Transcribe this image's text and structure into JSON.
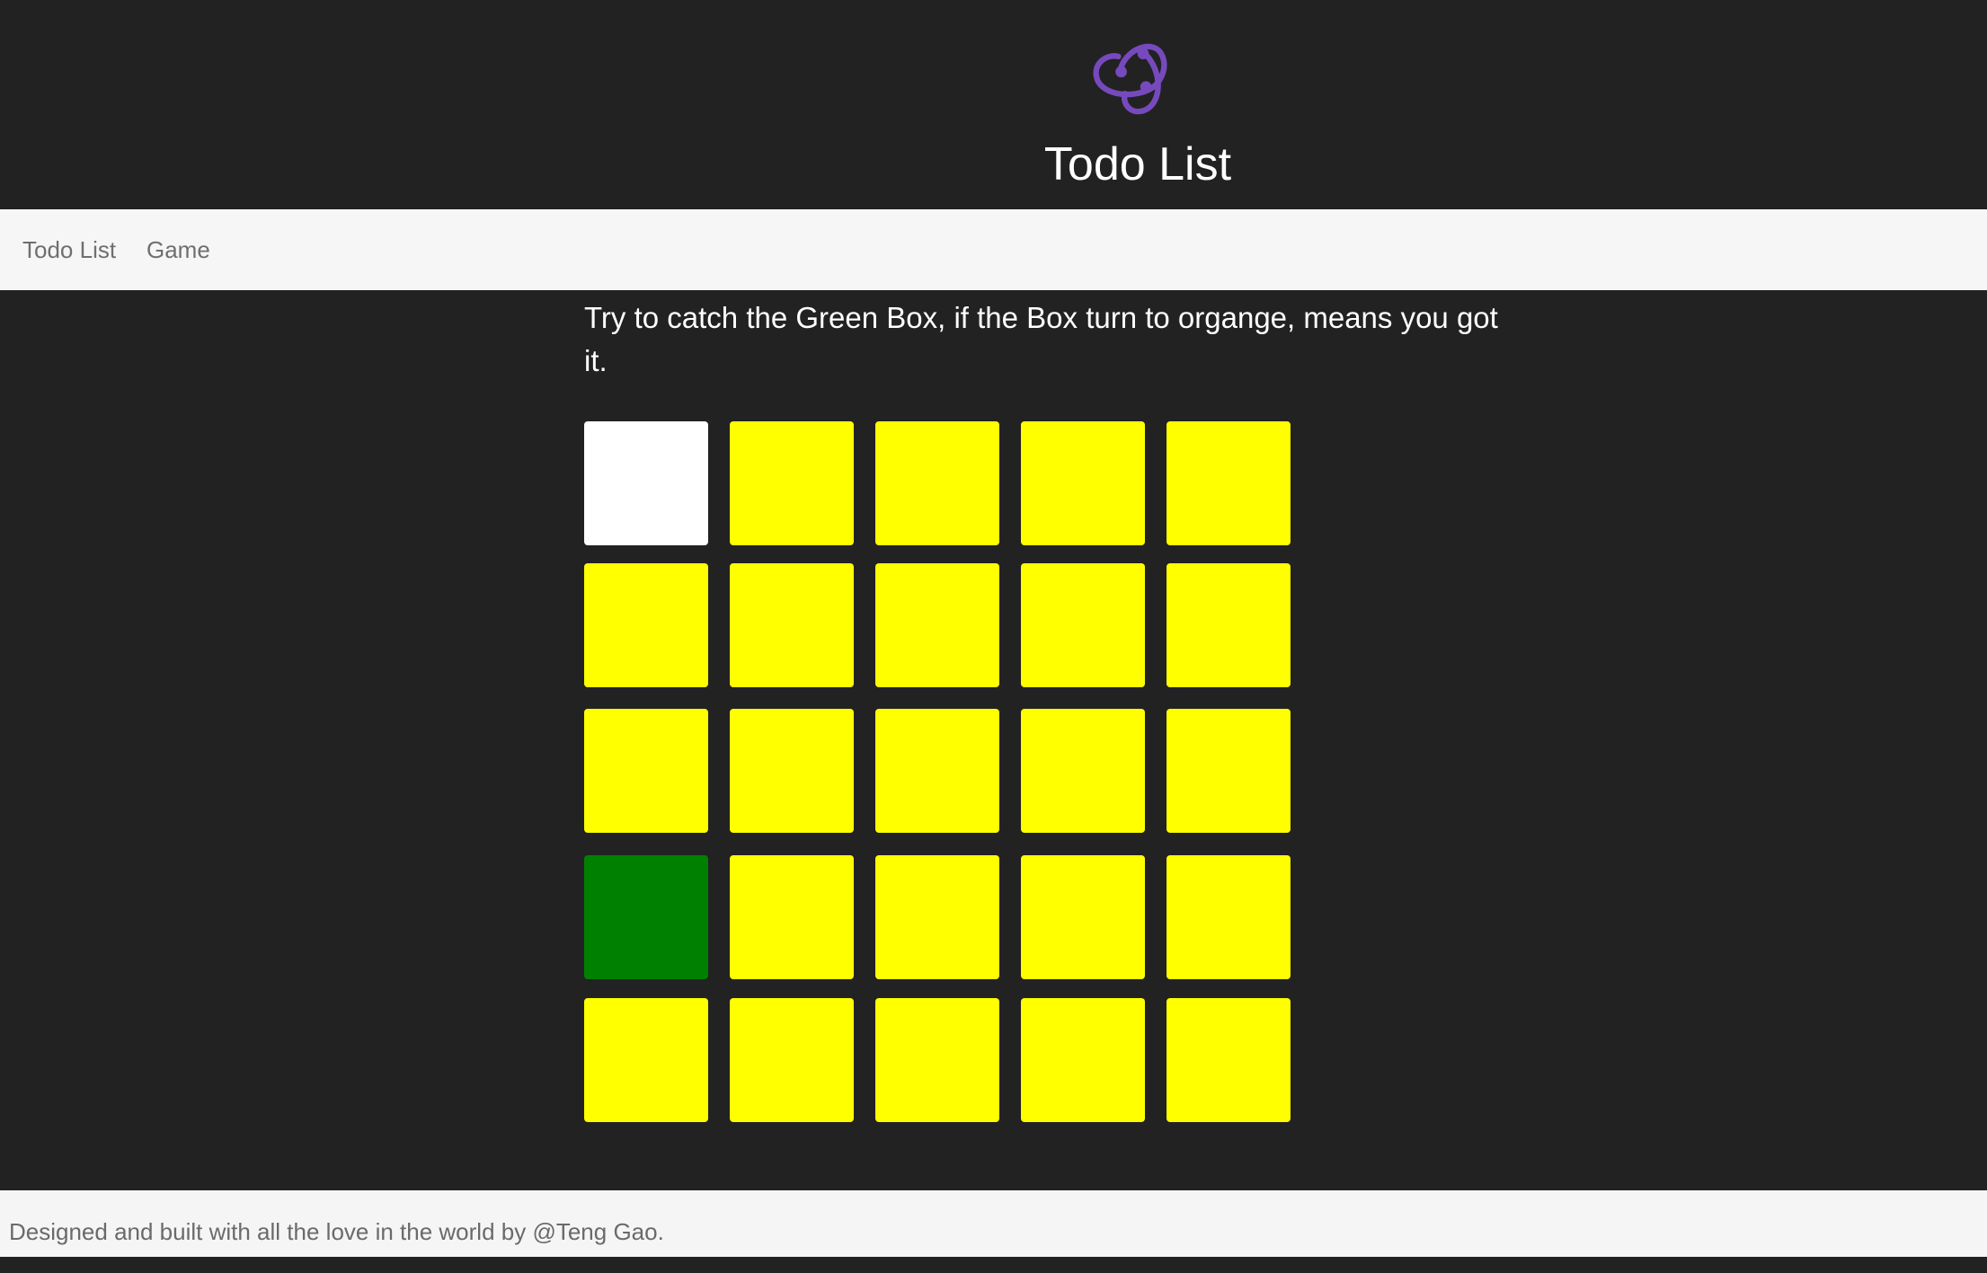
{
  "header": {
    "logo_icon": "redux-logo-icon",
    "logo_color": "#764abc",
    "title": "Todo List"
  },
  "nav": {
    "items": [
      {
        "label": "Todo List"
      },
      {
        "label": "Game"
      }
    ]
  },
  "main": {
    "instructions": "Try to catch the Green Box, if the Box turn to organge, means you got it."
  },
  "game": {
    "rows": 5,
    "cols": 5,
    "colors": {
      "white": "#ffffff",
      "yellow": "#ffff00",
      "green": "#008000"
    },
    "cells": [
      [
        "white",
        "yellow",
        "yellow",
        "yellow",
        "yellow"
      ],
      [
        "yellow",
        "yellow",
        "yellow",
        "yellow",
        "yellow"
      ],
      [
        "yellow",
        "yellow",
        "yellow",
        "yellow",
        "yellow"
      ],
      [
        "green",
        "yellow",
        "yellow",
        "yellow",
        "yellow"
      ],
      [
        "yellow",
        "yellow",
        "yellow",
        "yellow",
        "yellow"
      ]
    ]
  },
  "footer": {
    "text": "Designed and built with all the love in the world by @Teng Gao."
  }
}
